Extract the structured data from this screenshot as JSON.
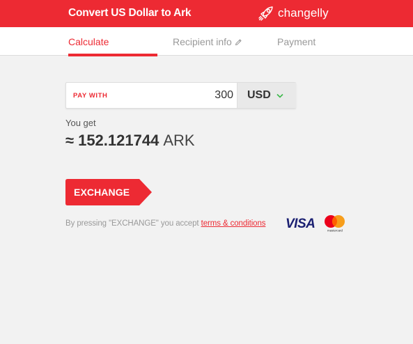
{
  "header": {
    "title": "Convert US Dollar to Ark",
    "brand": "changelly"
  },
  "tabs": [
    {
      "label": "Calculate",
      "active": true
    },
    {
      "label": "Recipient info",
      "active": false
    },
    {
      "label": "Payment",
      "active": false
    }
  ],
  "calculator": {
    "pay_with_label": "PAY WITH",
    "amount": "300",
    "currency": "USD",
    "you_get_label": "You get",
    "approx_symbol": "≈",
    "result_value": "152.121744",
    "result_unit": "ARK"
  },
  "exchange_button": {
    "label": "EXCHANGE"
  },
  "terms": {
    "prefix": "By pressing \"EXCHANGE\" you accept ",
    "link_text": "terms & conditions"
  },
  "payment_logos": {
    "visa": "VISA",
    "mastercard_text": "mastercard"
  },
  "colors": {
    "accent": "#ed2a33",
    "background": "#f2f2f2",
    "visa_blue": "#1a1f71"
  },
  "icons": [
    "rocket-icon",
    "pencil-icon",
    "chevron-down-icon",
    "mastercard-logo"
  ]
}
